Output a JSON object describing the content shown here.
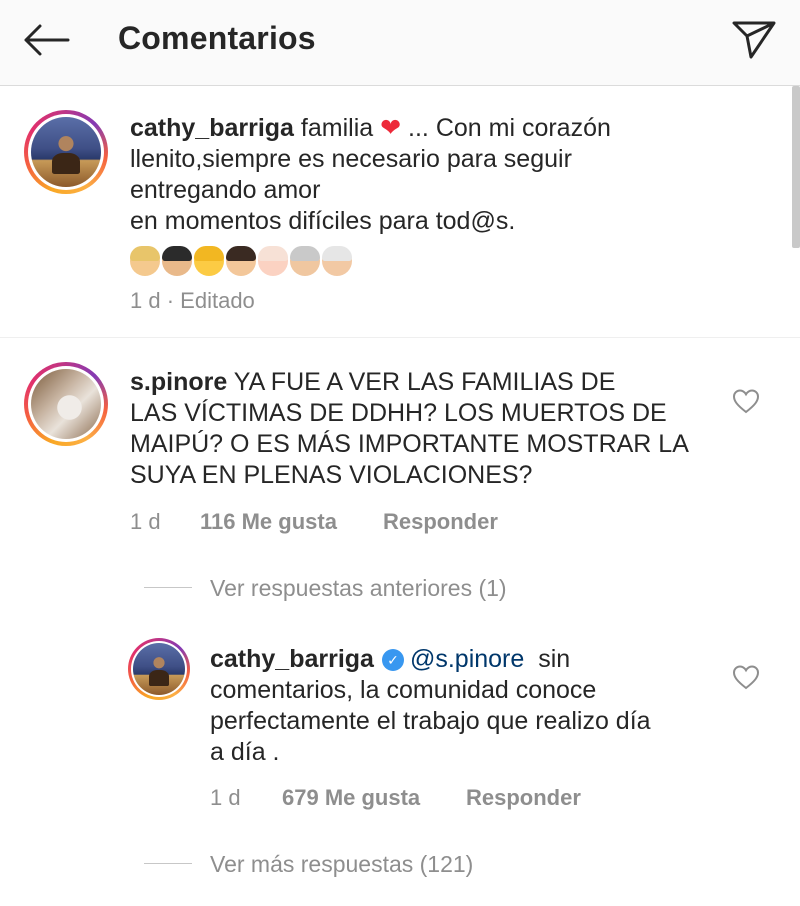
{
  "header": {
    "title": "Comentarios",
    "back_icon": "arrow-left-icon",
    "send_icon": "paper-plane-icon"
  },
  "caption": {
    "username": "cathy_barriga",
    "text_1": "familia",
    "text_2": "... Con mi corazón",
    "text_3": "llenito,siempre es  necesario para seguir",
    "text_4": "entregando amor",
    "text_5": "en momentos difíciles para tod@s.",
    "time": "1 d",
    "separator": "·",
    "edited": "Editado"
  },
  "comment": {
    "username": "s.pinore",
    "line_1": "YA FUE A VER LAS FAMILIAS DE",
    "line_2": "LAS VÍCTIMAS DE DDHH? LOS MUERTOS DE",
    "line_3": "MAIPÚ? O ES MÁS IMPORTANTE MOSTRAR LA",
    "line_4": "SUYA EN PLENAS VIOLACIONES?",
    "time": "1 d",
    "likes": "116 Me gusta",
    "reply": "Responder"
  },
  "view_previous": "Ver respuestas anteriores (1)",
  "reply": {
    "username": "cathy_barriga",
    "mention": "@s.pinore",
    "line_1": "sin",
    "line_2": "comentarios, la comunidad conoce",
    "line_3": "perfectamente el trabajo que realizo día",
    "line_4": "a día .",
    "time": "1 d",
    "likes": "679 Me gusta",
    "reply": "Responder"
  },
  "view_more": "Ver más respuestas (121)",
  "colors": {
    "text": "#262626",
    "muted": "#8e8e8e",
    "mention": "#00376b",
    "verified": "#3897f0",
    "heart": "#ed2a3a"
  }
}
